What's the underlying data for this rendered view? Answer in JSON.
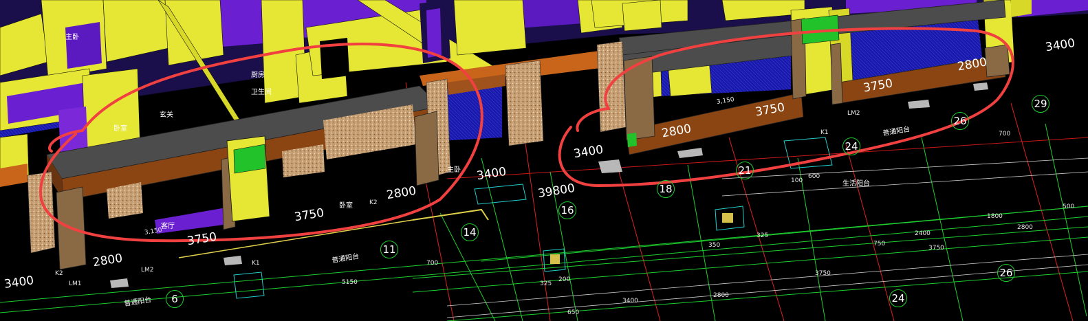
{
  "colors": {
    "background": "#000000",
    "wall": "#e6e634",
    "wall_shade": "#bfbf22",
    "beam": "#8b4513",
    "beam_top": "#a0521d",
    "slab": "#4a4a4a",
    "column": "#8a6a45",
    "aggregate": "#c8a57a",
    "green_block": "#22c32a",
    "window": "#6a1fd0",
    "grid_line": "#1ecf2f",
    "axis_line": "#e02020",
    "markup": "#f04040"
  },
  "icons": [
    "grid-axis-bubble",
    "column-section-symbol"
  ],
  "labels": {
    "left_3400": "3400",
    "left_2800": "2800",
    "left_3750a": "3750",
    "left_3750b": "3750",
    "left_2800b": "2800",
    "mid_3400": "3400",
    "mid_39800": "39800",
    "right_3400": "3400",
    "right_2800": "2800",
    "right_3750": "3750",
    "right_3750b": "3750",
    "right_2800b": "2800",
    "far_3400": "3400"
  },
  "grid_axes": [
    "6",
    "11",
    "14",
    "16",
    "18",
    "21",
    "24",
    "26",
    "24",
    "26",
    "29"
  ],
  "cad_text": {
    "t1": "3.150",
    "t2": "3,150",
    "t3": "卧室",
    "t4": "客厅",
    "t5": "普通阳台",
    "t6": "玄关",
    "t7": "主卧",
    "t8": "K2",
    "t9": "K1",
    "t10": "5150",
    "t11": "2800",
    "t12": "3750",
    "t13": "3400",
    "t14": "650",
    "t15": "700",
    "t16": "750",
    "t17": "1800",
    "t18": "2400",
    "t19": "500",
    "t20": "100",
    "t21": "600",
    "t22": "325",
    "t23": "350",
    "t24": "200",
    "t25": "厨房",
    "t26": "卫生间",
    "t27": "生活阳台",
    "t28": "LM2",
    "t29": "LM1",
    "t30": "主卧",
    "t31": "卧室"
  }
}
